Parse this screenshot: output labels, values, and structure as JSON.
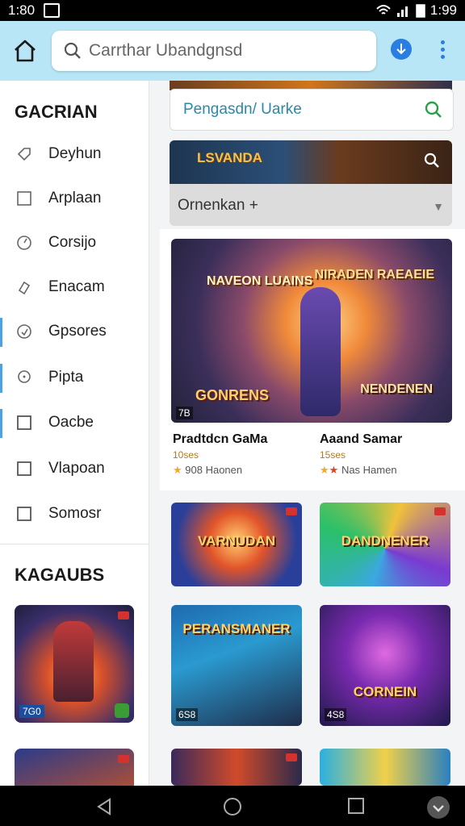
{
  "status": {
    "time": "1:80",
    "time_right": "1:99"
  },
  "topbar": {
    "search_text": "Carrthar Ubandgnsd"
  },
  "sidebar": {
    "section1": "GACRIAN",
    "items": [
      {
        "label": "Deyhun",
        "icon": "tag-icon"
      },
      {
        "label": "Arplaan",
        "icon": "square-icon"
      },
      {
        "label": "Corsijo",
        "icon": "compass-icon"
      },
      {
        "label": "Enacam",
        "icon": "link-icon"
      },
      {
        "label": "Gpsores",
        "icon": "refresh-icon"
      },
      {
        "label": "Pipta",
        "icon": "location-icon"
      },
      {
        "label": "Oacbe",
        "icon": "checkbox-icon"
      },
      {
        "label": "Vlapoan",
        "icon": "checkbox-icon"
      },
      {
        "label": "Somosr",
        "icon": "checkbox-icon"
      }
    ],
    "section2": "KAGAUBS",
    "card1_badge": "7G0"
  },
  "main": {
    "filter_text": "Pengasdn/ Uarke",
    "banner_logo": "LSVANDA",
    "sort_label": "Ornenkan +",
    "featured": {
      "title1": "NAVEON LUAINS",
      "title2": "NIRADEN RAEAEIE",
      "title3": "GONRENS",
      "title4": "NENDENEN",
      "badge": "7B",
      "left_name": "Pradtdcn GaMa",
      "left_sub": "10ses",
      "left_rating": "908 Haonen",
      "right_name": "Aaand Samar",
      "right_sub": "15ses",
      "right_rating": "Nas Hamen"
    },
    "grid": [
      {
        "title": "VARNUDAN",
        "badge": ""
      },
      {
        "title": "DANDNENER",
        "badge": ""
      },
      {
        "title": "PERANSMANER",
        "badge": "6S8"
      },
      {
        "title": "CORNEIN",
        "badge": "4S8"
      }
    ]
  },
  "colors": {
    "accent": "#2a7de1",
    "topbar": "#b9e6f6"
  }
}
